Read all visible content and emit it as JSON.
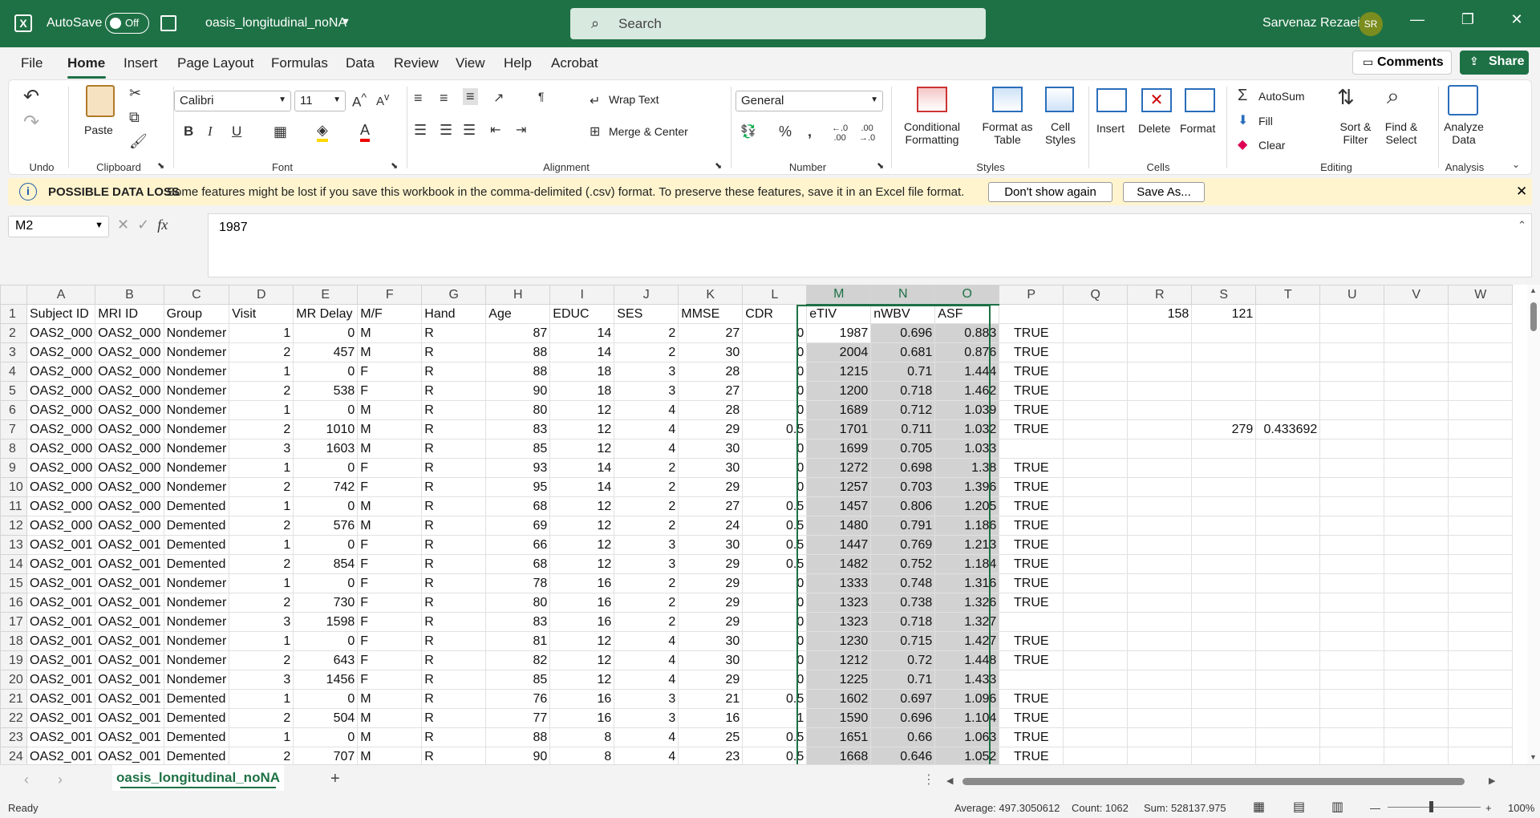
{
  "titlebar": {
    "app_icon": "excel-icon",
    "autosave_label": "AutoSave",
    "autosave_state": "Off",
    "filename": "oasis_longitudinal_noNA",
    "search_placeholder": "Search",
    "user_name": "Sarvenaz Rezaei",
    "user_initials": "SR",
    "minimize": "—",
    "restore": "❐",
    "close": "✕"
  },
  "menu": {
    "tabs": [
      "File",
      "Home",
      "Insert",
      "Page Layout",
      "Formulas",
      "Data",
      "Review",
      "View",
      "Help",
      "Acrobat"
    ],
    "active_tab": "Home",
    "comments_label": "Comments",
    "share_label": "Share"
  },
  "ribbon": {
    "groups": {
      "undo": "Undo",
      "clipboard": "Clipboard",
      "font": "Font",
      "alignment": "Alignment",
      "number": "Number",
      "styles": "Styles",
      "cells": "Cells",
      "editing": "Editing",
      "analysis": "Analysis"
    },
    "paste_label": "Paste",
    "font_name": "Calibri",
    "font_size": "11",
    "wrap_text": "Wrap Text",
    "merge_center": "Merge & Center",
    "number_format": "General",
    "conditional_formatting": [
      "Conditional",
      "Formatting"
    ],
    "format_as_table": [
      "Format as",
      "Table"
    ],
    "cell_styles": [
      "Cell",
      "Styles"
    ],
    "insert": "Insert",
    "delete": "Delete",
    "format": "Format",
    "autosum": "AutoSum",
    "fill": "Fill",
    "clear": "Clear",
    "sort_filter": [
      "Sort &",
      "Filter"
    ],
    "find_select": [
      "Find &",
      "Select"
    ],
    "analyze_data": [
      "Analyze",
      "Data"
    ]
  },
  "warning": {
    "title": "POSSIBLE DATA LOSS",
    "text": "Some features might be lost if you save this workbook in the comma-delimited (.csv) format. To preserve these features, save it in an Excel file format.",
    "dont_show": "Don't show again",
    "save_as": "Save As..."
  },
  "formula_bar": {
    "name_box": "M2",
    "fx": "fx",
    "value": "1987"
  },
  "columns": [
    "A",
    "B",
    "C",
    "D",
    "E",
    "F",
    "G",
    "H",
    "I",
    "J",
    "K",
    "L",
    "M",
    "N",
    "O",
    "P",
    "Q",
    "R",
    "S",
    "T",
    "U",
    "V",
    "W"
  ],
  "rows": [
    [
      "Subject ID",
      "MRI ID",
      "Group",
      "Visit",
      "MR Delay",
      "M/F",
      "Hand",
      "Age",
      "EDUC",
      "SES",
      "MMSE",
      "CDR",
      "eTIV",
      "nWBV",
      "ASF",
      "",
      "",
      "158",
      "121",
      "",
      "",
      "",
      ""
    ],
    [
      "OAS2_000",
      "OAS2_000",
      "Nondemer",
      "1",
      "0",
      "M",
      "R",
      "87",
      "14",
      "2",
      "27",
      "0",
      "1987",
      "0.696",
      "0.883",
      "TRUE",
      "",
      "",
      "",
      "",
      "",
      "",
      ""
    ],
    [
      "OAS2_000",
      "OAS2_000",
      "Nondemer",
      "2",
      "457",
      "M",
      "R",
      "88",
      "14",
      "2",
      "30",
      "0",
      "2004",
      "0.681",
      "0.876",
      "TRUE",
      "",
      "",
      "",
      "",
      "",
      "",
      ""
    ],
    [
      "OAS2_000",
      "OAS2_000",
      "Nondemer",
      "1",
      "0",
      "F",
      "R",
      "88",
      "18",
      "3",
      "28",
      "0",
      "1215",
      "0.71",
      "1.444",
      "TRUE",
      "",
      "",
      "",
      "",
      "",
      "",
      ""
    ],
    [
      "OAS2_000",
      "OAS2_000",
      "Nondemer",
      "2",
      "538",
      "F",
      "R",
      "90",
      "18",
      "3",
      "27",
      "0",
      "1200",
      "0.718",
      "1.462",
      "TRUE",
      "",
      "",
      "",
      "",
      "",
      "",
      ""
    ],
    [
      "OAS2_000",
      "OAS2_000",
      "Nondemer",
      "1",
      "0",
      "M",
      "R",
      "80",
      "12",
      "4",
      "28",
      "0",
      "1689",
      "0.712",
      "1.039",
      "TRUE",
      "",
      "",
      "",
      "",
      "",
      "",
      ""
    ],
    [
      "OAS2_000",
      "OAS2_000",
      "Nondemer",
      "2",
      "1010",
      "M",
      "R",
      "83",
      "12",
      "4",
      "29",
      "0.5",
      "1701",
      "0.711",
      "1.032",
      "TRUE",
      "",
      "",
      "279",
      "0.433692",
      "",
      "",
      ""
    ],
    [
      "OAS2_000",
      "OAS2_000",
      "Nondemer",
      "3",
      "1603",
      "M",
      "R",
      "85",
      "12",
      "4",
      "30",
      "0",
      "1699",
      "0.705",
      "1.033",
      "",
      "",
      "",
      "",
      "",
      "",
      "",
      ""
    ],
    [
      "OAS2_000",
      "OAS2_000",
      "Nondemer",
      "1",
      "0",
      "F",
      "R",
      "93",
      "14",
      "2",
      "30",
      "0",
      "1272",
      "0.698",
      "1.38",
      "TRUE",
      "",
      "",
      "",
      "",
      "",
      "",
      ""
    ],
    [
      "OAS2_000",
      "OAS2_000",
      "Nondemer",
      "2",
      "742",
      "F",
      "R",
      "95",
      "14",
      "2",
      "29",
      "0",
      "1257",
      "0.703",
      "1.396",
      "TRUE",
      "",
      "",
      "",
      "",
      "",
      "",
      ""
    ],
    [
      "OAS2_000",
      "OAS2_000",
      "Demented",
      "1",
      "0",
      "M",
      "R",
      "68",
      "12",
      "2",
      "27",
      "0.5",
      "1457",
      "0.806",
      "1.205",
      "TRUE",
      "",
      "",
      "",
      "",
      "",
      "",
      ""
    ],
    [
      "OAS2_000",
      "OAS2_000",
      "Demented",
      "2",
      "576",
      "M",
      "R",
      "69",
      "12",
      "2",
      "24",
      "0.5",
      "1480",
      "0.791",
      "1.186",
      "TRUE",
      "",
      "",
      "",
      "",
      "",
      "",
      ""
    ],
    [
      "OAS2_001",
      "OAS2_001",
      "Demented",
      "1",
      "0",
      "F",
      "R",
      "66",
      "12",
      "3",
      "30",
      "0.5",
      "1447",
      "0.769",
      "1.213",
      "TRUE",
      "",
      "",
      "",
      "",
      "",
      "",
      ""
    ],
    [
      "OAS2_001",
      "OAS2_001",
      "Demented",
      "2",
      "854",
      "F",
      "R",
      "68",
      "12",
      "3",
      "29",
      "0.5",
      "1482",
      "0.752",
      "1.184",
      "TRUE",
      "",
      "",
      "",
      "",
      "",
      "",
      ""
    ],
    [
      "OAS2_001",
      "OAS2_001",
      "Nondemer",
      "1",
      "0",
      "F",
      "R",
      "78",
      "16",
      "2",
      "29",
      "0",
      "1333",
      "0.748",
      "1.316",
      "TRUE",
      "",
      "",
      "",
      "",
      "",
      "",
      ""
    ],
    [
      "OAS2_001",
      "OAS2_001",
      "Nondemer",
      "2",
      "730",
      "F",
      "R",
      "80",
      "16",
      "2",
      "29",
      "0",
      "1323",
      "0.738",
      "1.326",
      "TRUE",
      "",
      "",
      "",
      "",
      "",
      "",
      ""
    ],
    [
      "OAS2_001",
      "OAS2_001",
      "Nondemer",
      "3",
      "1598",
      "F",
      "R",
      "83",
      "16",
      "2",
      "29",
      "0",
      "1323",
      "0.718",
      "1.327",
      "",
      "",
      "",
      "",
      "",
      "",
      "",
      ""
    ],
    [
      "OAS2_001",
      "OAS2_001",
      "Nondemer",
      "1",
      "0",
      "F",
      "R",
      "81",
      "12",
      "4",
      "30",
      "0",
      "1230",
      "0.715",
      "1.427",
      "TRUE",
      "",
      "",
      "",
      "",
      "",
      "",
      ""
    ],
    [
      "OAS2_001",
      "OAS2_001",
      "Nondemer",
      "2",
      "643",
      "F",
      "R",
      "82",
      "12",
      "4",
      "30",
      "0",
      "1212",
      "0.72",
      "1.448",
      "TRUE",
      "",
      "",
      "",
      "",
      "",
      "",
      ""
    ],
    [
      "OAS2_001",
      "OAS2_001",
      "Nondemer",
      "3",
      "1456",
      "F",
      "R",
      "85",
      "12",
      "4",
      "29",
      "0",
      "1225",
      "0.71",
      "1.433",
      "",
      "",
      "",
      "",
      "",
      "",
      "",
      ""
    ],
    [
      "OAS2_001",
      "OAS2_001",
      "Demented",
      "1",
      "0",
      "M",
      "R",
      "76",
      "16",
      "3",
      "21",
      "0.5",
      "1602",
      "0.697",
      "1.096",
      "TRUE",
      "",
      "",
      "",
      "",
      "",
      "",
      ""
    ],
    [
      "OAS2_001",
      "OAS2_001",
      "Demented",
      "2",
      "504",
      "M",
      "R",
      "77",
      "16",
      "3",
      "16",
      "1",
      "1590",
      "0.696",
      "1.104",
      "TRUE",
      "",
      "",
      "",
      "",
      "",
      "",
      ""
    ],
    [
      "OAS2_001",
      "OAS2_001",
      "Demented",
      "1",
      "0",
      "M",
      "R",
      "88",
      "8",
      "4",
      "25",
      "0.5",
      "1651",
      "0.66",
      "1.063",
      "TRUE",
      "",
      "",
      "",
      "",
      "",
      "",
      ""
    ],
    [
      "OAS2_001",
      "OAS2_001",
      "Demented",
      "2",
      "707",
      "M",
      "R",
      "90",
      "8",
      "4",
      "23",
      "0.5",
      "1668",
      "0.646",
      "1.052",
      "TRUE",
      "",
      "",
      "",
      "",
      "",
      "",
      ""
    ]
  ],
  "sheet_tab": "oasis_longitudinal_noNA",
  "status": {
    "ready": "Ready",
    "average": "Average: 497.3050612",
    "count": "Count: 1062",
    "sum": "Sum: 528137.975",
    "zoom": "100%"
  },
  "colors": {
    "brand": "#1e7145",
    "warning_bg": "#fff4ce",
    "selection_fill": "#d2d2d2"
  }
}
